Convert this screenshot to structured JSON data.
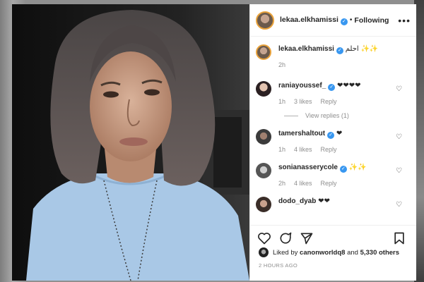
{
  "post": {
    "author": "lekaa.elkhamissi",
    "follow_status": "Following",
    "more_label": "•••",
    "caption": {
      "username": "lekaa.elkhamissi",
      "text": "احلم ✨✨",
      "time": "2h"
    }
  },
  "comments": [
    {
      "username": "raniayoussef_",
      "verified": true,
      "text": "❤❤❤❤",
      "time": "1h",
      "likes": "3 likes",
      "reply": "Reply",
      "view_replies": "View replies (1)"
    },
    {
      "username": "tamershaltout",
      "verified": true,
      "text": "❤",
      "time": "1h",
      "likes": "4 likes",
      "reply": "Reply"
    },
    {
      "username": "sonianasserycole",
      "verified": true,
      "text": "✨✨",
      "time": "2h",
      "likes": "4 likes",
      "reply": "Reply"
    },
    {
      "username": "dodo_dyab",
      "verified": false,
      "text": "❤❤",
      "time": "",
      "likes": "",
      "reply": ""
    }
  ],
  "likes": {
    "prefix": "Liked by",
    "user": "canonworldq8",
    "middle": "and",
    "others": "5,330 others"
  },
  "timestamp": "2 HOURS AGO",
  "colors": {
    "verified": "#3897f0",
    "muted": "#8e8e8e",
    "text": "#262626",
    "sweater": "#a9c8e6"
  }
}
